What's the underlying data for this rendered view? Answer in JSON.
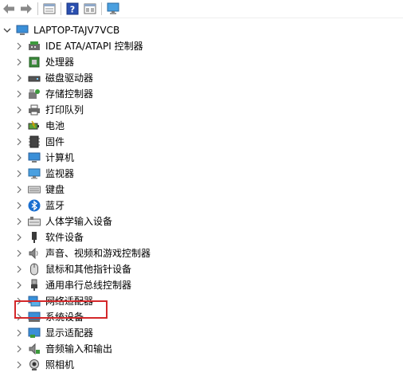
{
  "toolbar": {
    "buttons": [
      {
        "icon": "back-arrow-icon"
      },
      {
        "icon": "forward-arrow-icon"
      },
      {
        "icon": "properties-icon"
      },
      {
        "icon": "help-icon"
      },
      {
        "icon": "show-hidden-icon"
      },
      {
        "icon": "monitor-icon"
      }
    ]
  },
  "tree": {
    "root": {
      "label": "LAPTOP-TAJV7VCB",
      "icon": "computer-icon"
    },
    "categories": [
      {
        "label": "IDE ATA/ATAPI 控制器",
        "icon": "ide-controller-icon"
      },
      {
        "label": "处理器",
        "icon": "processor-icon"
      },
      {
        "label": "磁盘驱动器",
        "icon": "disk-drive-icon"
      },
      {
        "label": "存储控制器",
        "icon": "storage-controller-icon"
      },
      {
        "label": "打印队列",
        "icon": "printer-icon"
      },
      {
        "label": "电池",
        "icon": "battery-icon"
      },
      {
        "label": "固件",
        "icon": "firmware-icon"
      },
      {
        "label": "计算机",
        "icon": "computer-icon"
      },
      {
        "label": "监视器",
        "icon": "monitor-icon"
      },
      {
        "label": "键盘",
        "icon": "keyboard-icon"
      },
      {
        "label": "蓝牙",
        "icon": "bluetooth-icon"
      },
      {
        "label": "人体学输入设备",
        "icon": "hid-icon"
      },
      {
        "label": "软件设备",
        "icon": "software-device-icon"
      },
      {
        "label": "声音、视频和游戏控制器",
        "icon": "sound-icon"
      },
      {
        "label": "鼠标和其他指针设备",
        "icon": "mouse-icon"
      },
      {
        "label": "通用串行总线控制器",
        "icon": "usb-icon"
      },
      {
        "label": "网络适配器",
        "icon": "network-adapter-icon"
      },
      {
        "label": "系统设备",
        "icon": "system-device-icon"
      },
      {
        "label": "显示适配器",
        "icon": "display-adapter-icon"
      },
      {
        "label": "音频输入和输出",
        "icon": "audio-io-icon"
      },
      {
        "label": "照相机",
        "icon": "camera-icon"
      }
    ]
  },
  "colors": {
    "highlight_border": "#d4282a",
    "chevron": "#707070"
  }
}
